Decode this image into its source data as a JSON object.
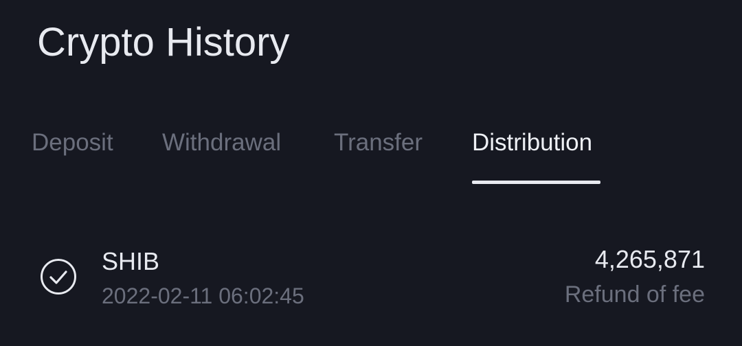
{
  "header": {
    "title": "Crypto History"
  },
  "tabs": [
    {
      "label": "Deposit",
      "active": false
    },
    {
      "label": "Withdrawal",
      "active": false
    },
    {
      "label": "Transfer",
      "active": false
    },
    {
      "label": "Distribution",
      "active": true
    }
  ],
  "records": [
    {
      "status_icon": "check-circle-icon",
      "coin": "SHIB",
      "datetime": "2022-02-11 06:02:45",
      "amount": "4,265,871",
      "note": "Refund of fee"
    }
  ],
  "colors": {
    "background": "#161821",
    "text_primary": "#e8eaf0",
    "text_muted": "#6b6f7d",
    "tab_indicator": "#e8eaf0"
  }
}
